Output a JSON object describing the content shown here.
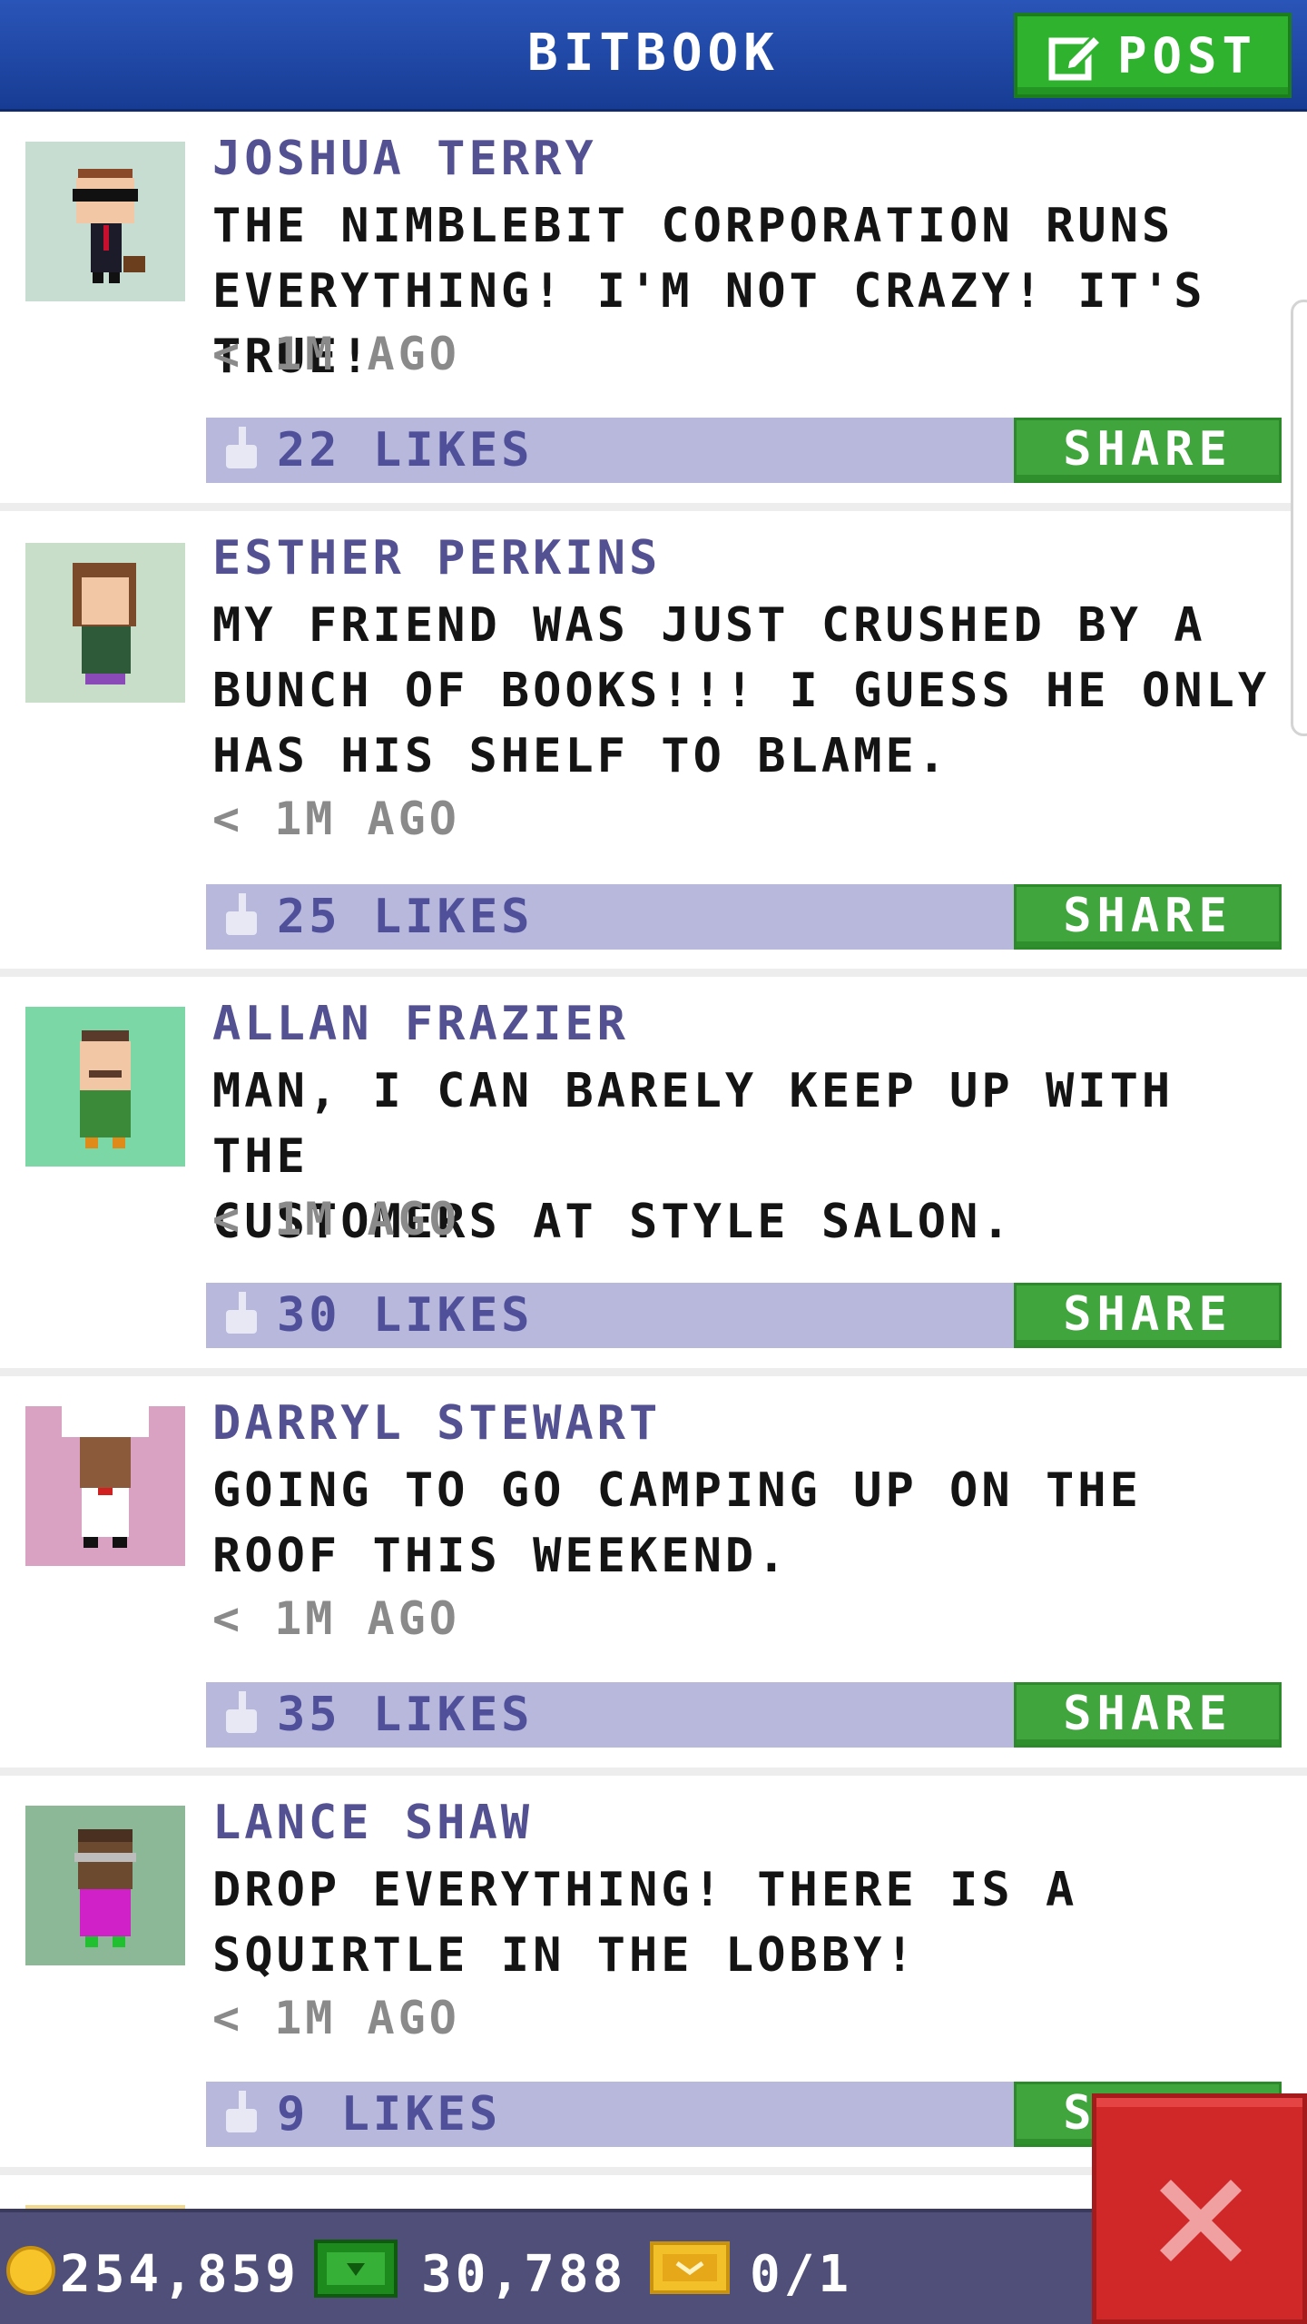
{
  "header": {
    "title": "BITBOOK",
    "post_label": "POST"
  },
  "posts": [
    {
      "author": "JOSHUA TERRY",
      "lines": [
        "THE NIMBLEBIT CORPORATION RUNS",
        "EVERYTHING! I'M NOT CRAZY! IT'S TRUE!"
      ],
      "time": "< 1M AGO",
      "likes": "22 LIKES",
      "share": "SHARE",
      "avatar_bg": "#c7ddd2"
    },
    {
      "author": "ESTHER PERKINS",
      "lines": [
        "MY FRIEND WAS JUST CRUSHED BY A",
        "BUNCH OF BOOKS!!! I GUESS HE ONLY",
        "HAS HIS SHELF TO BLAME."
      ],
      "time": "< 1M AGO",
      "likes": "25 LIKES",
      "share": "SHARE",
      "avatar_bg": "#c9dec9"
    },
    {
      "author": "ALLAN FRAZIER",
      "lines": [
        "MAN, I CAN BARELY KEEP UP WITH THE",
        "CUSTOMERS AT STYLE SALON."
      ],
      "time": "< 1M AGO",
      "likes": "30 LIKES",
      "share": "SHARE",
      "avatar_bg": "#7bd7a6"
    },
    {
      "author": "DARRYL STEWART",
      "lines": [
        "GOING TO GO CAMPING UP ON THE",
        "ROOF THIS WEEKEND."
      ],
      "time": "< 1M AGO",
      "likes": "35 LIKES",
      "share": "SHARE",
      "avatar_bg": "#d9a2c2"
    },
    {
      "author": "LANCE SHAW",
      "lines": [
        "DROP EVERYTHING! THERE IS A",
        "SQUIRTLE IN THE LOBBY!"
      ],
      "time": "< 1M AGO",
      "likes": "9 LIKES",
      "share": "SHARE",
      "avatar_bg": "#8db897"
    }
  ],
  "bottom_bar": {
    "coins": "254,859",
    "bux": "30,788",
    "tickets": "0/1"
  },
  "colors": {
    "header": "#1f4aa8",
    "share_green": "#3fa53c",
    "likes_bar": "#b7b8dc",
    "author_text": "#545192",
    "close_red": "#d02828"
  },
  "icons": [
    "edit-icon",
    "thumbs-up-icon",
    "coin-icon",
    "bux-icon",
    "ticket-icon",
    "close-icon"
  ]
}
